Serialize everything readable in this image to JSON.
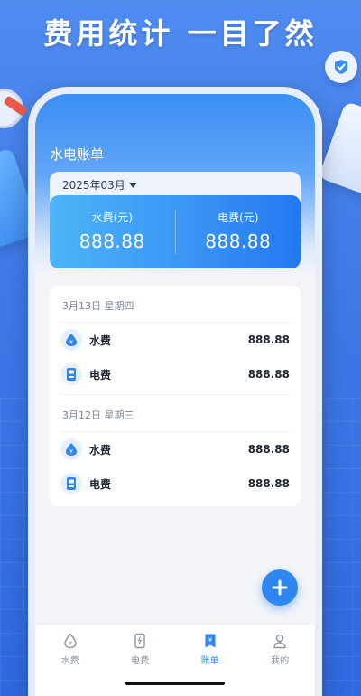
{
  "promo": {
    "title": "费用统计 一目了然"
  },
  "page": {
    "title": "水电账单"
  },
  "filter": {
    "month": "2025年03月"
  },
  "summary": {
    "water": {
      "label": "水费(元)",
      "value": "888.88"
    },
    "electric": {
      "label": "电费(元)",
      "value": "888.88"
    }
  },
  "days": [
    {
      "date": "3月13日 星期四",
      "items": [
        {
          "label": "水费",
          "amount": "888.88",
          "icon": "water-drop-icon"
        },
        {
          "label": "电费",
          "amount": "888.88",
          "icon": "electric-meter-icon"
        }
      ]
    },
    {
      "date": "3月12日 星期三",
      "items": [
        {
          "label": "水费",
          "amount": "888.88",
          "icon": "water-drop-icon"
        },
        {
          "label": "电费",
          "amount": "888.88",
          "icon": "electric-meter-icon"
        }
      ]
    }
  ],
  "fab": {
    "icon": "plus-icon"
  },
  "tabs": [
    {
      "label": "水费",
      "icon": "water-drop-icon",
      "active": false
    },
    {
      "label": "电费",
      "icon": "electric-meter-icon",
      "active": false
    },
    {
      "label": "账单",
      "icon": "bill-icon",
      "active": true
    },
    {
      "label": "我的",
      "icon": "user-icon",
      "active": false
    }
  ],
  "colors": {
    "accent": "#2f86ee",
    "background": "#3f7ae8"
  }
}
